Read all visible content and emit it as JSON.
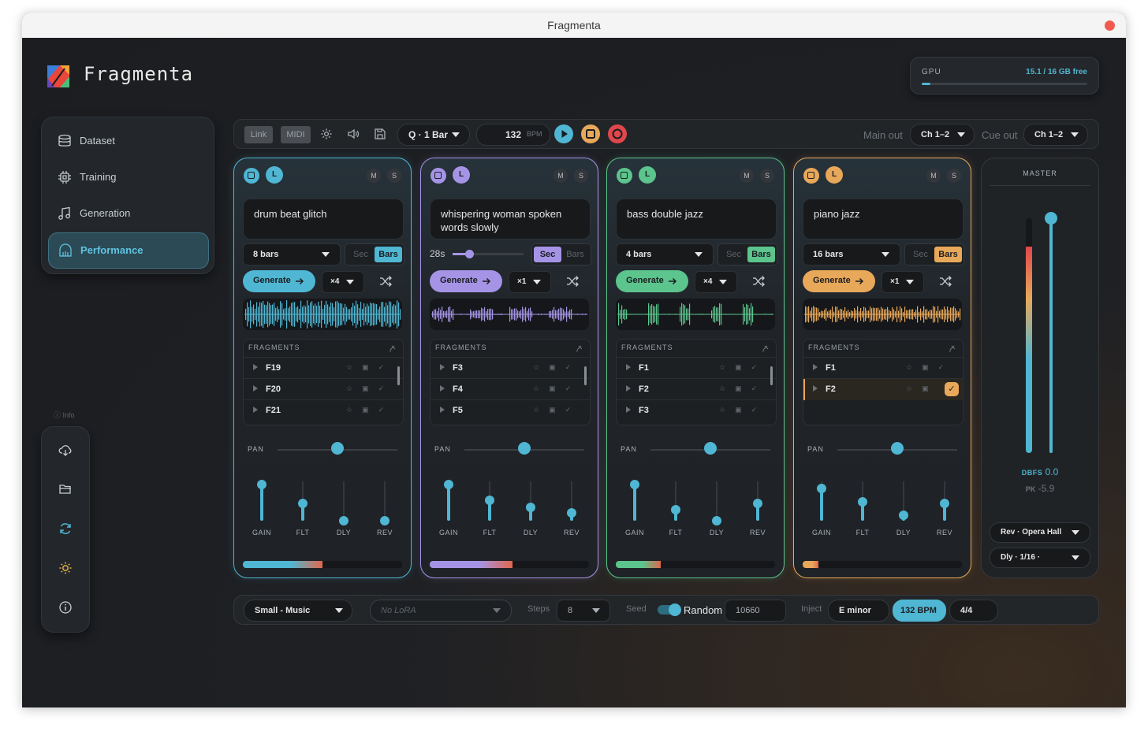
{
  "window": {
    "title": "Fragmenta"
  },
  "app": {
    "brand": "Fragmenta"
  },
  "gpu": {
    "label": "GPU",
    "value": "15.1 / 16 GB free",
    "usage_fraction": 0.05
  },
  "nav": {
    "items": [
      {
        "label": "Dataset",
        "icon": "database-icon"
      },
      {
        "label": "Training",
        "icon": "chip-icon"
      },
      {
        "label": "Generation",
        "icon": "music-note-icon"
      },
      {
        "label": "Performance",
        "icon": "performance-icon",
        "active": true
      }
    ]
  },
  "sidebar_tools": {
    "info_label": "ⓘ Info",
    "icons": [
      "cloud-download-icon",
      "folder-open-icon",
      "refresh-icon",
      "sun-icon",
      "info-icon"
    ]
  },
  "toolbar": {
    "link": "Link",
    "midi": "MIDI",
    "quantize": "Q · 1 Bar",
    "bpm": "132",
    "bpm_unit": "BPM",
    "main_out_label": "Main out",
    "main_out_value": "Ch 1–2",
    "cue_out_label": "Cue out",
    "cue_out_value": "Ch 1–2"
  },
  "channels": [
    {
      "color": "#4fb6d3",
      "loop": "L",
      "mute": "M",
      "solo": "S",
      "prompt": "drum beat glitch",
      "length": "8 bars",
      "unit_sec": "Sec",
      "unit_bars": "Bars",
      "unit_active": "bars",
      "generate": "Generate",
      "multiplier": "×4",
      "fragments_label": "FRAGMENTS",
      "fragments": [
        "F19",
        "F20",
        "F21"
      ],
      "pan_label": "PAN",
      "pan": 0.5,
      "faders": [
        {
          "label": "GAIN",
          "value": 0.95
        },
        {
          "label": "FLT",
          "value": 0.45
        },
        {
          "label": "DLY",
          "value": 0.0
        },
        {
          "label": "REV",
          "value": 0.0
        }
      ],
      "level": 0.5
    },
    {
      "color": "#a594e6",
      "loop": "L",
      "mute": "M",
      "solo": "S",
      "prompt": "whispering woman spoken words slowly",
      "length": "28s",
      "unit_sec": "Sec",
      "unit_bars": "Bars",
      "unit_active": "sec",
      "generate": "Generate",
      "multiplier": "×1",
      "fragments_label": "FRAGMENTS",
      "fragments": [
        "F3",
        "F4",
        "F5"
      ],
      "pan_label": "PAN",
      "pan": 0.5,
      "faders": [
        {
          "label": "GAIN",
          "value": 0.95
        },
        {
          "label": "FLT",
          "value": 0.55
        },
        {
          "label": "DLY",
          "value": 0.35
        },
        {
          "label": "REV",
          "value": 0.2
        }
      ],
      "level": 0.52
    },
    {
      "color": "#5cc48d",
      "loop": "L",
      "mute": "M",
      "solo": "S",
      "prompt": "bass double jazz",
      "length": "4 bars",
      "unit_sec": "Sec",
      "unit_bars": "Bars",
      "unit_active": "bars",
      "generate": "Generate",
      "multiplier": "×4",
      "fragments_label": "FRAGMENTS",
      "fragments": [
        "F1",
        "F2",
        "F3"
      ],
      "pan_label": "PAN",
      "pan": 0.5,
      "faders": [
        {
          "label": "GAIN",
          "value": 0.95
        },
        {
          "label": "FLT",
          "value": 0.3
        },
        {
          "label": "DLY",
          "value": 0.0
        },
        {
          "label": "REV",
          "value": 0.45
        }
      ],
      "level": 0.28
    },
    {
      "color": "#e8a85a",
      "loop": "L",
      "mute": "M",
      "solo": "S",
      "prompt": "piano jazz",
      "length": "16 bars",
      "unit_sec": "Sec",
      "unit_bars": "Bars",
      "unit_active": "bars",
      "generate": "Generate",
      "multiplier": "×1",
      "fragments_label": "FRAGMENTS",
      "fragments": [
        "F1",
        "F2"
      ],
      "selected_fragment": 1,
      "pan_label": "PAN",
      "pan": 0.5,
      "faders": [
        {
          "label": "GAIN",
          "value": 0.85
        },
        {
          "label": "FLT",
          "value": 0.5
        },
        {
          "label": "DLY",
          "value": 0.15
        },
        {
          "label": "REV",
          "value": 0.45
        }
      ],
      "level": 0.1
    }
  ],
  "master": {
    "label": "MASTER",
    "dbfs_label": "DBFS",
    "dbfs_value": "0.0",
    "pk_label": "PK",
    "pk_value": "-5.9",
    "level": 0.88,
    "fader": 1.0,
    "reverb": "Rev · Opera Hall",
    "delay": "Dly · 1/16 ·"
  },
  "bottom": {
    "model": "Small - Music",
    "lora_placeholder": "No LoRA",
    "steps_label": "Steps",
    "steps": "8",
    "seed_label": "Seed",
    "random_label": "Random",
    "random_on": true,
    "seed": "10660",
    "inject_label": "Inject",
    "key": "E minor",
    "bpm": "132 BPM",
    "time_sig": "4/4"
  }
}
